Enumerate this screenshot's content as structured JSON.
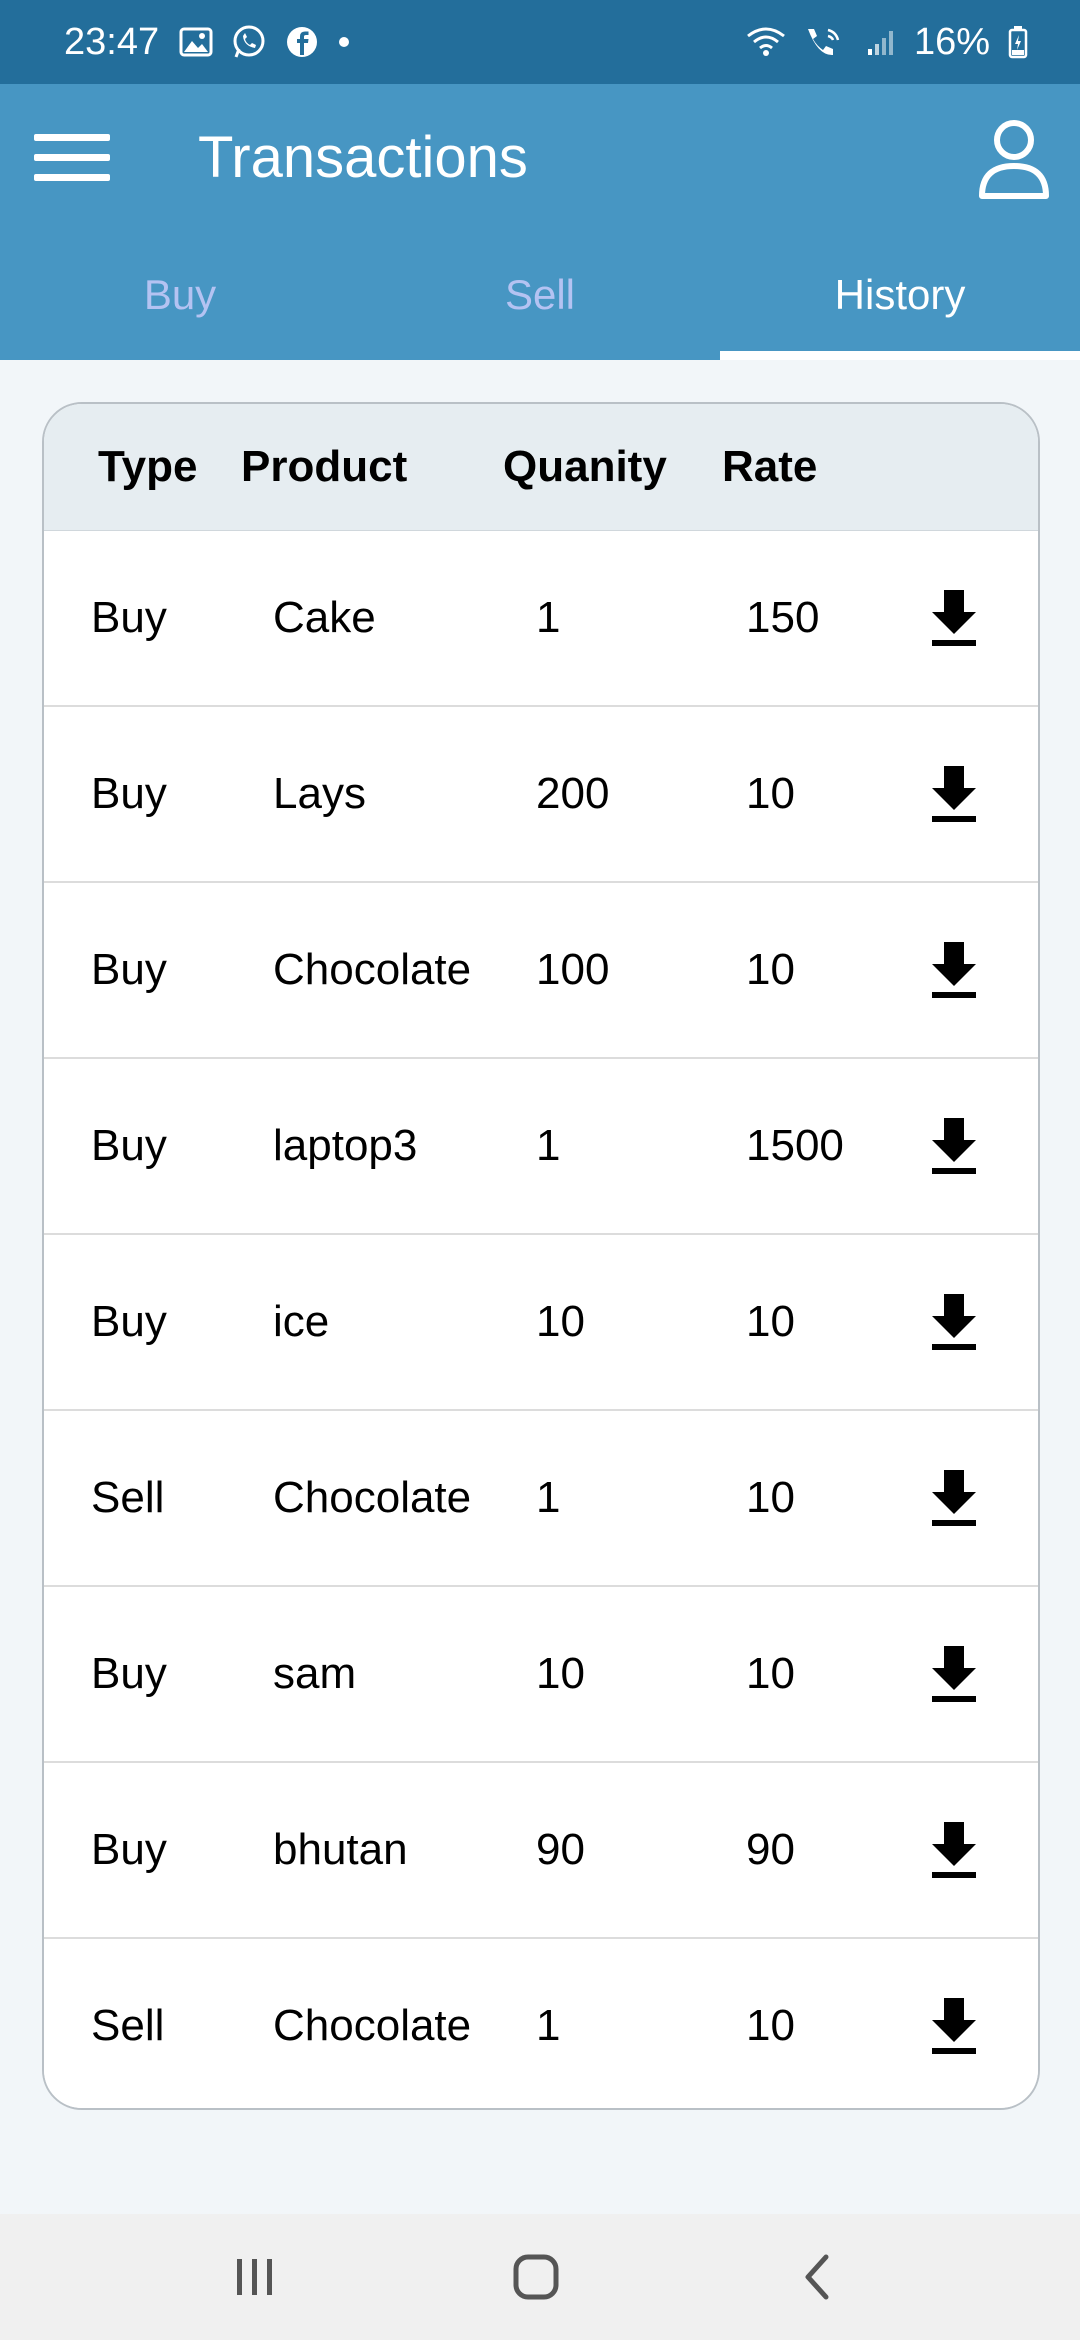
{
  "status_bar": {
    "time": "23:47",
    "left_icons": [
      "image-icon",
      "whatsapp-icon",
      "facebook-icon",
      "dot-icon"
    ],
    "right_icons": [
      "wifi-icon",
      "wifi-calling-icon",
      "signal-icon",
      "battery-icon"
    ],
    "battery": "16%"
  },
  "app_bar": {
    "title": "Transactions",
    "menu_icon": "menu-icon",
    "account_icon": "account-icon"
  },
  "tabs": [
    {
      "label": "Buy",
      "active": false
    },
    {
      "label": "Sell",
      "active": false
    },
    {
      "label": "History",
      "active": true
    }
  ],
  "table": {
    "headers": [
      "Type",
      "Product",
      "Quanity",
      "Rate"
    ],
    "rows": [
      {
        "type": "Buy",
        "product": "Cake",
        "quantity": "1",
        "rate": "150"
      },
      {
        "type": "Buy",
        "product": "Lays",
        "quantity": "200",
        "rate": "10"
      },
      {
        "type": "Buy",
        "product": "Chocolate",
        "quantity": "100",
        "rate": "10"
      },
      {
        "type": "Buy",
        "product": "laptop3",
        "quantity": "1",
        "rate": "1500"
      },
      {
        "type": "Buy",
        "product": "ice",
        "quantity": "10",
        "rate": "10"
      },
      {
        "type": "Sell",
        "product": "Chocolate",
        "quantity": "1",
        "rate": "10"
      },
      {
        "type": "Buy",
        "product": "sam",
        "quantity": "10",
        "rate": "10"
      },
      {
        "type": "Buy",
        "product": "bhutan",
        "quantity": "90",
        "rate": "90"
      },
      {
        "type": "Sell",
        "product": "Chocolate",
        "quantity": "1",
        "rate": "10"
      }
    ],
    "row_action_icon": "download-icon"
  },
  "nav_bar": {
    "buttons": [
      "recent-apps-icon",
      "home-icon",
      "back-icon"
    ]
  },
  "colors": {
    "status_bar": "#236e9b",
    "app_bar": "#4796c3",
    "tab_inactive": "#b4c3f2",
    "tab_active": "#ffffff",
    "table_header": "#e6edf1",
    "page_background": "#f2f6f9"
  }
}
